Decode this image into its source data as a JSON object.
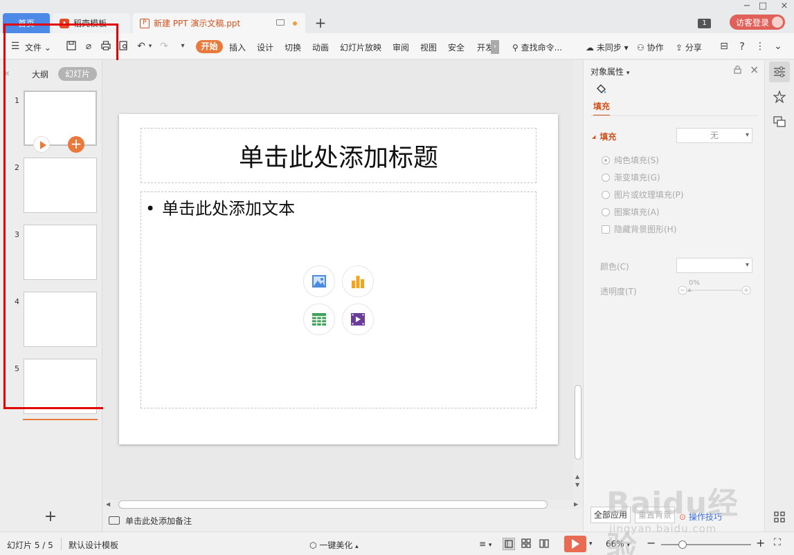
{
  "tabs": {
    "home": "首页",
    "template": "稻壳模板",
    "document": "新建 PPT 演示文稿.ppt",
    "new_tab": "+"
  },
  "titlebar": {
    "window_count": "1",
    "visitor_login": "访客登录",
    "minimize": "−",
    "maximize": "□",
    "close": "×"
  },
  "toolbar": {
    "file_menu": "文件",
    "start": "开始",
    "menus": [
      "插入",
      "设计",
      "切换",
      "动画",
      "幻灯片放映",
      "审阅",
      "视图",
      "安全",
      "开发"
    ],
    "search": "查找命令...",
    "sync": "未同步",
    "collaborate": "协作",
    "share": "分享",
    "help": "?"
  },
  "left_panel": {
    "tab_outline": "大纲",
    "tab_slides": "幻灯片",
    "slide_numbers": [
      "1",
      "2",
      "3",
      "4",
      "5"
    ],
    "add_slide": "+"
  },
  "slide": {
    "title_placeholder": "单击此处添加标题",
    "body_placeholder": "单击此处添加文本"
  },
  "notes": {
    "placeholder": "单击此处添加备注"
  },
  "properties": {
    "panel_title": "对象属性",
    "fill_tab": "填充",
    "fill_section": "填充",
    "fill_select": "无",
    "options": [
      "纯色填充(S)",
      "渐变填充(G)",
      "图片或纹理填充(P)",
      "图案填充(A)"
    ],
    "hide_bg": "隐藏背景图形(H)",
    "color_label": "颜色(C)",
    "transparency_label": "透明度(T)",
    "transparency_value": "0%",
    "apply_all": "全部应用",
    "reset_bg": "重置背景",
    "tips": "操作技巧"
  },
  "statusbar": {
    "slide_info": "幻灯片 5 / 5",
    "design_template": "默认设计模板",
    "beautify": "一键美化",
    "zoom": "66%",
    "zoom_level": 0.24
  },
  "watermark": {
    "brand": "Baidu经验",
    "url": "jingyan.baidu.com"
  },
  "colors": {
    "accent_orange": "#e97a3e",
    "tab_blue": "#4d8ae8",
    "highlight_red": "#e20000"
  }
}
